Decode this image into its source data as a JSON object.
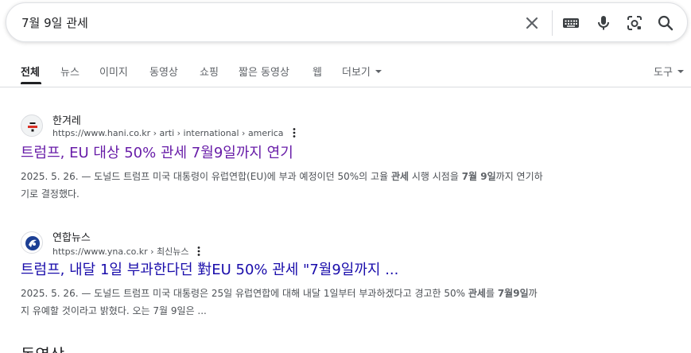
{
  "search": {
    "query": "7월 9일 관세"
  },
  "tabs": [
    {
      "label": "전체",
      "active": true
    },
    {
      "label": "뉴스"
    },
    {
      "label": "이미지"
    },
    {
      "label": "동영상"
    },
    {
      "label": "쇼핑"
    },
    {
      "label": "짧은 동영상"
    },
    {
      "label": "웹"
    },
    {
      "label": "더보기"
    }
  ],
  "tools_label": "도구",
  "results": [
    {
      "site_name": "한겨레",
      "url": "https://www.hani.co.kr › arti › international › america",
      "title": "트럼프, EU 대상 50% 관세 7월9일까지 연기",
      "date": "2025. 5. 26. — ",
      "snippet_parts": [
        "도널드 트럼프 미국 대통령이 유럽연합(EU)에 부과 예정이던 50%의 고율 ",
        "관세",
        " 시행 시점을 ",
        "7월 9일",
        "까지 연기하기로 결정했다."
      ]
    },
    {
      "site_name": "연합뉴스",
      "url": "https://www.yna.co.kr › 최신뉴스",
      "title": "트럼프, 내달 1일 부과한다던 對EU 50% 관세 \"7월9일까지 ...",
      "date": "2025. 5. 26. — ",
      "snippet_parts": [
        "도널드 트럼프 미국 대통령은 25일 유럽연합에 대해 내달 1일부터 부과하겠다고 경고한 50% ",
        "관세",
        "를 ",
        "7월9일",
        "까지 유예할 것이라고 밝혔다. 오는 7월 9일은 ..."
      ]
    }
  ],
  "next_section_heading": "동영상",
  "colors": {
    "visited_link": "#681da8",
    "link": "#1a0dab",
    "snippet": "#4d5156"
  }
}
